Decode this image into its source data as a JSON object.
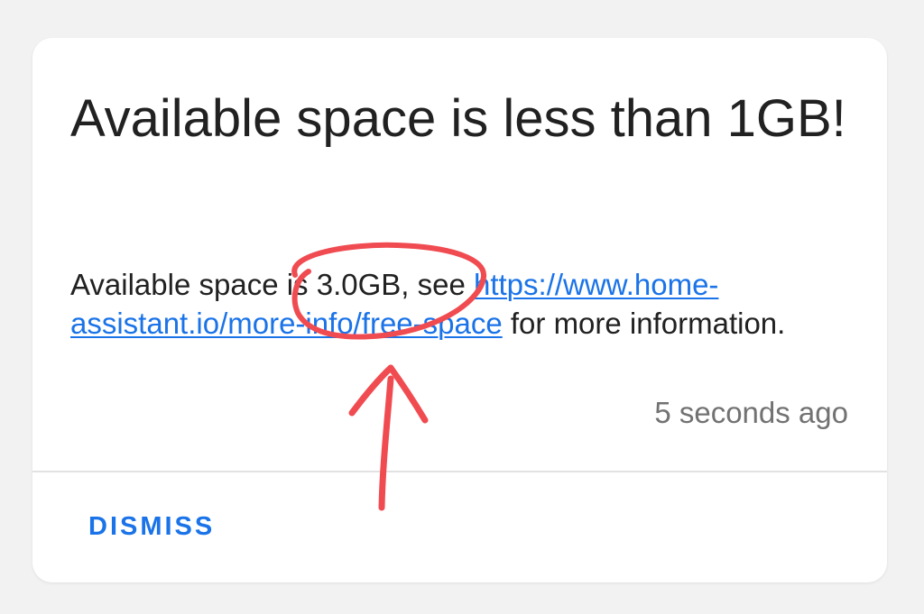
{
  "notification": {
    "title": "Available space is less than 1GB!",
    "message_before_link": "Available space is 3.0GB, see ",
    "link_text": "https://www.home-assistant.io/more-info/free-space",
    "message_after_link": " for more information.",
    "timestamp": "5 seconds ago",
    "dismiss_label": "DISMISS"
  },
  "colors": {
    "accent": "#1a73e8",
    "annotation": "#f04b50",
    "background": "#f2f2f2",
    "card": "#ffffff"
  }
}
